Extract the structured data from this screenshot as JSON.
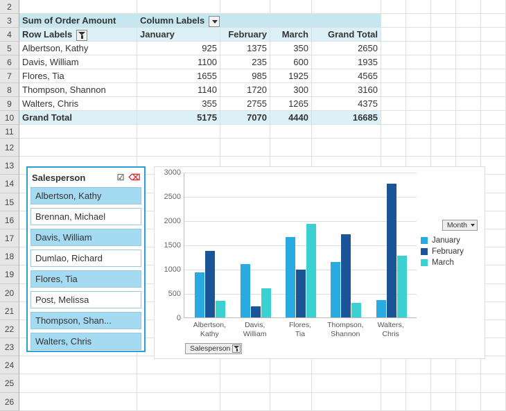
{
  "pivot": {
    "sum_label": "Sum of Order Amount",
    "col_label": "Column Labels",
    "row_label": "Row Labels",
    "months": [
      "January",
      "February",
      "March"
    ],
    "grand_total_label": "Grand Total",
    "rows": [
      {
        "name": "Albertson, Kathy",
        "vals": [
          925,
          1375,
          350
        ],
        "total": 2650
      },
      {
        "name": "Davis, William",
        "vals": [
          1100,
          235,
          600
        ],
        "total": 1935
      },
      {
        "name": "Flores, Tia",
        "vals": [
          1655,
          985,
          1925
        ],
        "total": 4565
      },
      {
        "name": "Thompson, Shannon",
        "vals": [
          1140,
          1720,
          300
        ],
        "total": 3160
      },
      {
        "name": "Walters, Chris",
        "vals": [
          355,
          2755,
          1265
        ],
        "total": 4375
      }
    ],
    "grand": {
      "vals": [
        5175,
        7070,
        4440
      ],
      "total": 16685
    }
  },
  "slicer": {
    "title": "Salesperson",
    "items": [
      {
        "label": "Albertson, Kathy",
        "selected": true
      },
      {
        "label": "Brennan, Michael",
        "selected": false
      },
      {
        "label": "Davis, William",
        "selected": true
      },
      {
        "label": "Dumlao, Richard",
        "selected": false
      },
      {
        "label": "Flores, Tia",
        "selected": true
      },
      {
        "label": "Post, Melissa",
        "selected": false
      },
      {
        "label": "Thompson, Shan...",
        "selected": true
      },
      {
        "label": "Walters, Chris",
        "selected": true
      }
    ]
  },
  "chart_data": {
    "type": "bar",
    "categories": [
      "Albertson, Kathy",
      "Davis, William",
      "Flores, Tia",
      "Thompson, Shannon",
      "Walters, Chris"
    ],
    "series": [
      {
        "name": "January",
        "values": [
          925,
          1100,
          1655,
          1140,
          355
        ]
      },
      {
        "name": "February",
        "values": [
          1375,
          235,
          985,
          1720,
          2755
        ]
      },
      {
        "name": "March",
        "values": [
          350,
          600,
          1925,
          300,
          1265
        ]
      }
    ],
    "ylim": [
      0,
      3000
    ],
    "ytick_step": 500,
    "legend_title": "Month",
    "axis_field": "Salesperson",
    "colors": [
      "#29abe2",
      "#1c5597",
      "#3bd1d1"
    ]
  },
  "row_numbers": [
    2,
    3,
    4,
    5,
    6,
    7,
    8,
    9,
    10,
    11,
    12,
    13,
    14,
    15,
    16,
    17,
    18,
    19,
    20,
    21,
    22,
    23,
    24,
    25,
    26
  ]
}
